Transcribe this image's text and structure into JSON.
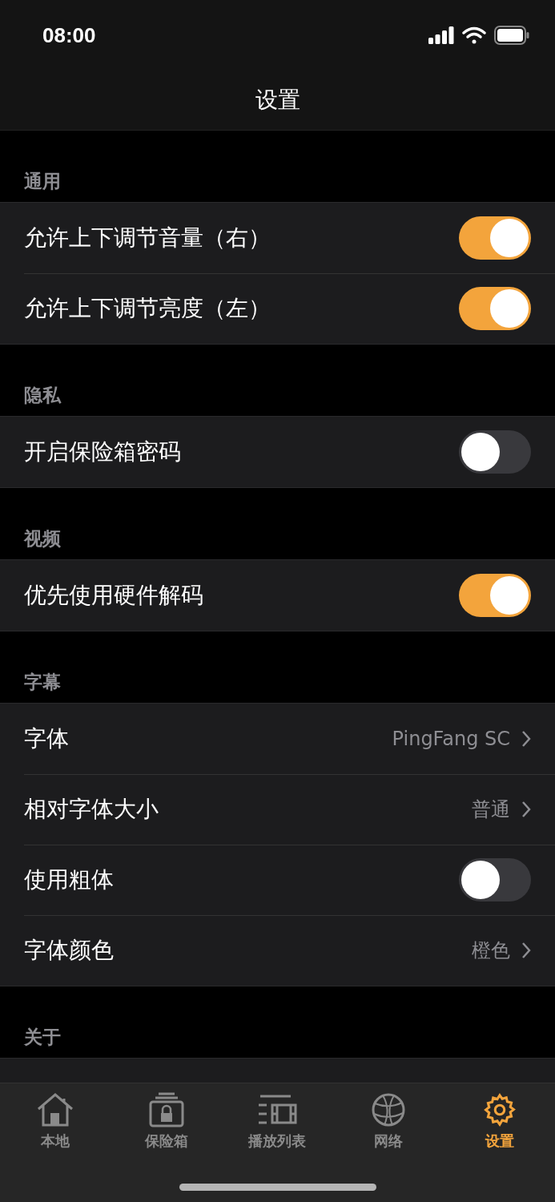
{
  "status_bar": {
    "time": "08:00"
  },
  "nav": {
    "title": "设置"
  },
  "sections": [
    {
      "header": "通用",
      "rows": [
        {
          "kind": "toggle",
          "label": "允许上下调节音量（右）",
          "on": true
        },
        {
          "kind": "toggle",
          "label": "允许上下调节亮度（左）",
          "on": true
        }
      ]
    },
    {
      "header": "隐私",
      "rows": [
        {
          "kind": "toggle",
          "label": "开启保险箱密码",
          "on": false
        }
      ]
    },
    {
      "header": "视频",
      "rows": [
        {
          "kind": "toggle",
          "label": "优先使用硬件解码",
          "on": true
        }
      ]
    },
    {
      "header": "字幕",
      "rows": [
        {
          "kind": "link",
          "label": "字体",
          "value": "PingFang SC"
        },
        {
          "kind": "link",
          "label": "相对字体大小",
          "value": "普通"
        },
        {
          "kind": "toggle",
          "label": "使用粗体",
          "on": false
        },
        {
          "kind": "link",
          "label": "字体颜色",
          "value": "橙色"
        }
      ]
    },
    {
      "header": "关于",
      "rows": [
        {
          "kind": "blank"
        }
      ]
    }
  ],
  "tab_bar": [
    {
      "kind": "home",
      "label": "本地",
      "selected": false
    },
    {
      "kind": "safe",
      "label": "保险箱",
      "selected": false
    },
    {
      "kind": "playlist",
      "label": "播放列表",
      "selected": false
    },
    {
      "kind": "globe",
      "label": "网络",
      "selected": false
    },
    {
      "kind": "gear",
      "label": "设置",
      "selected": true
    }
  ]
}
